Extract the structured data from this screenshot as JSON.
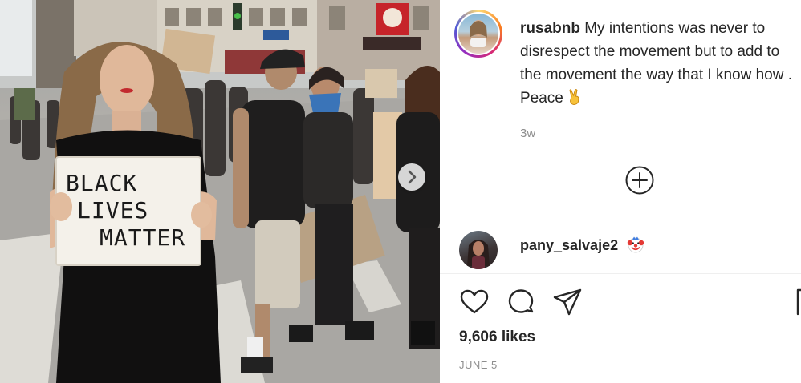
{
  "post": {
    "image": {
      "sign_lines": [
        "BLACK",
        "LIVES",
        "MATTER"
      ],
      "carousel_icon": "chevron-right-icon"
    },
    "author": {
      "username": "rusabnb",
      "avatar_icon": "avatar-image"
    },
    "caption": {
      "text": "My intentions was never to disrespect the movement but to add to the movement the way that I know how . Peace",
      "emoji": "victory-hand-emoji"
    },
    "time_ago": "3w",
    "load_more_icon": "plus-circle-icon",
    "comments": [
      {
        "username": "pany_salvaje2",
        "emoji": "clown-face-emoji"
      }
    ],
    "actions": {
      "icons": [
        "heart-icon",
        "comment-icon",
        "share-icon",
        "bookmark-icon"
      ]
    },
    "likes": "9,606 likes",
    "date": "JUNE 5"
  }
}
